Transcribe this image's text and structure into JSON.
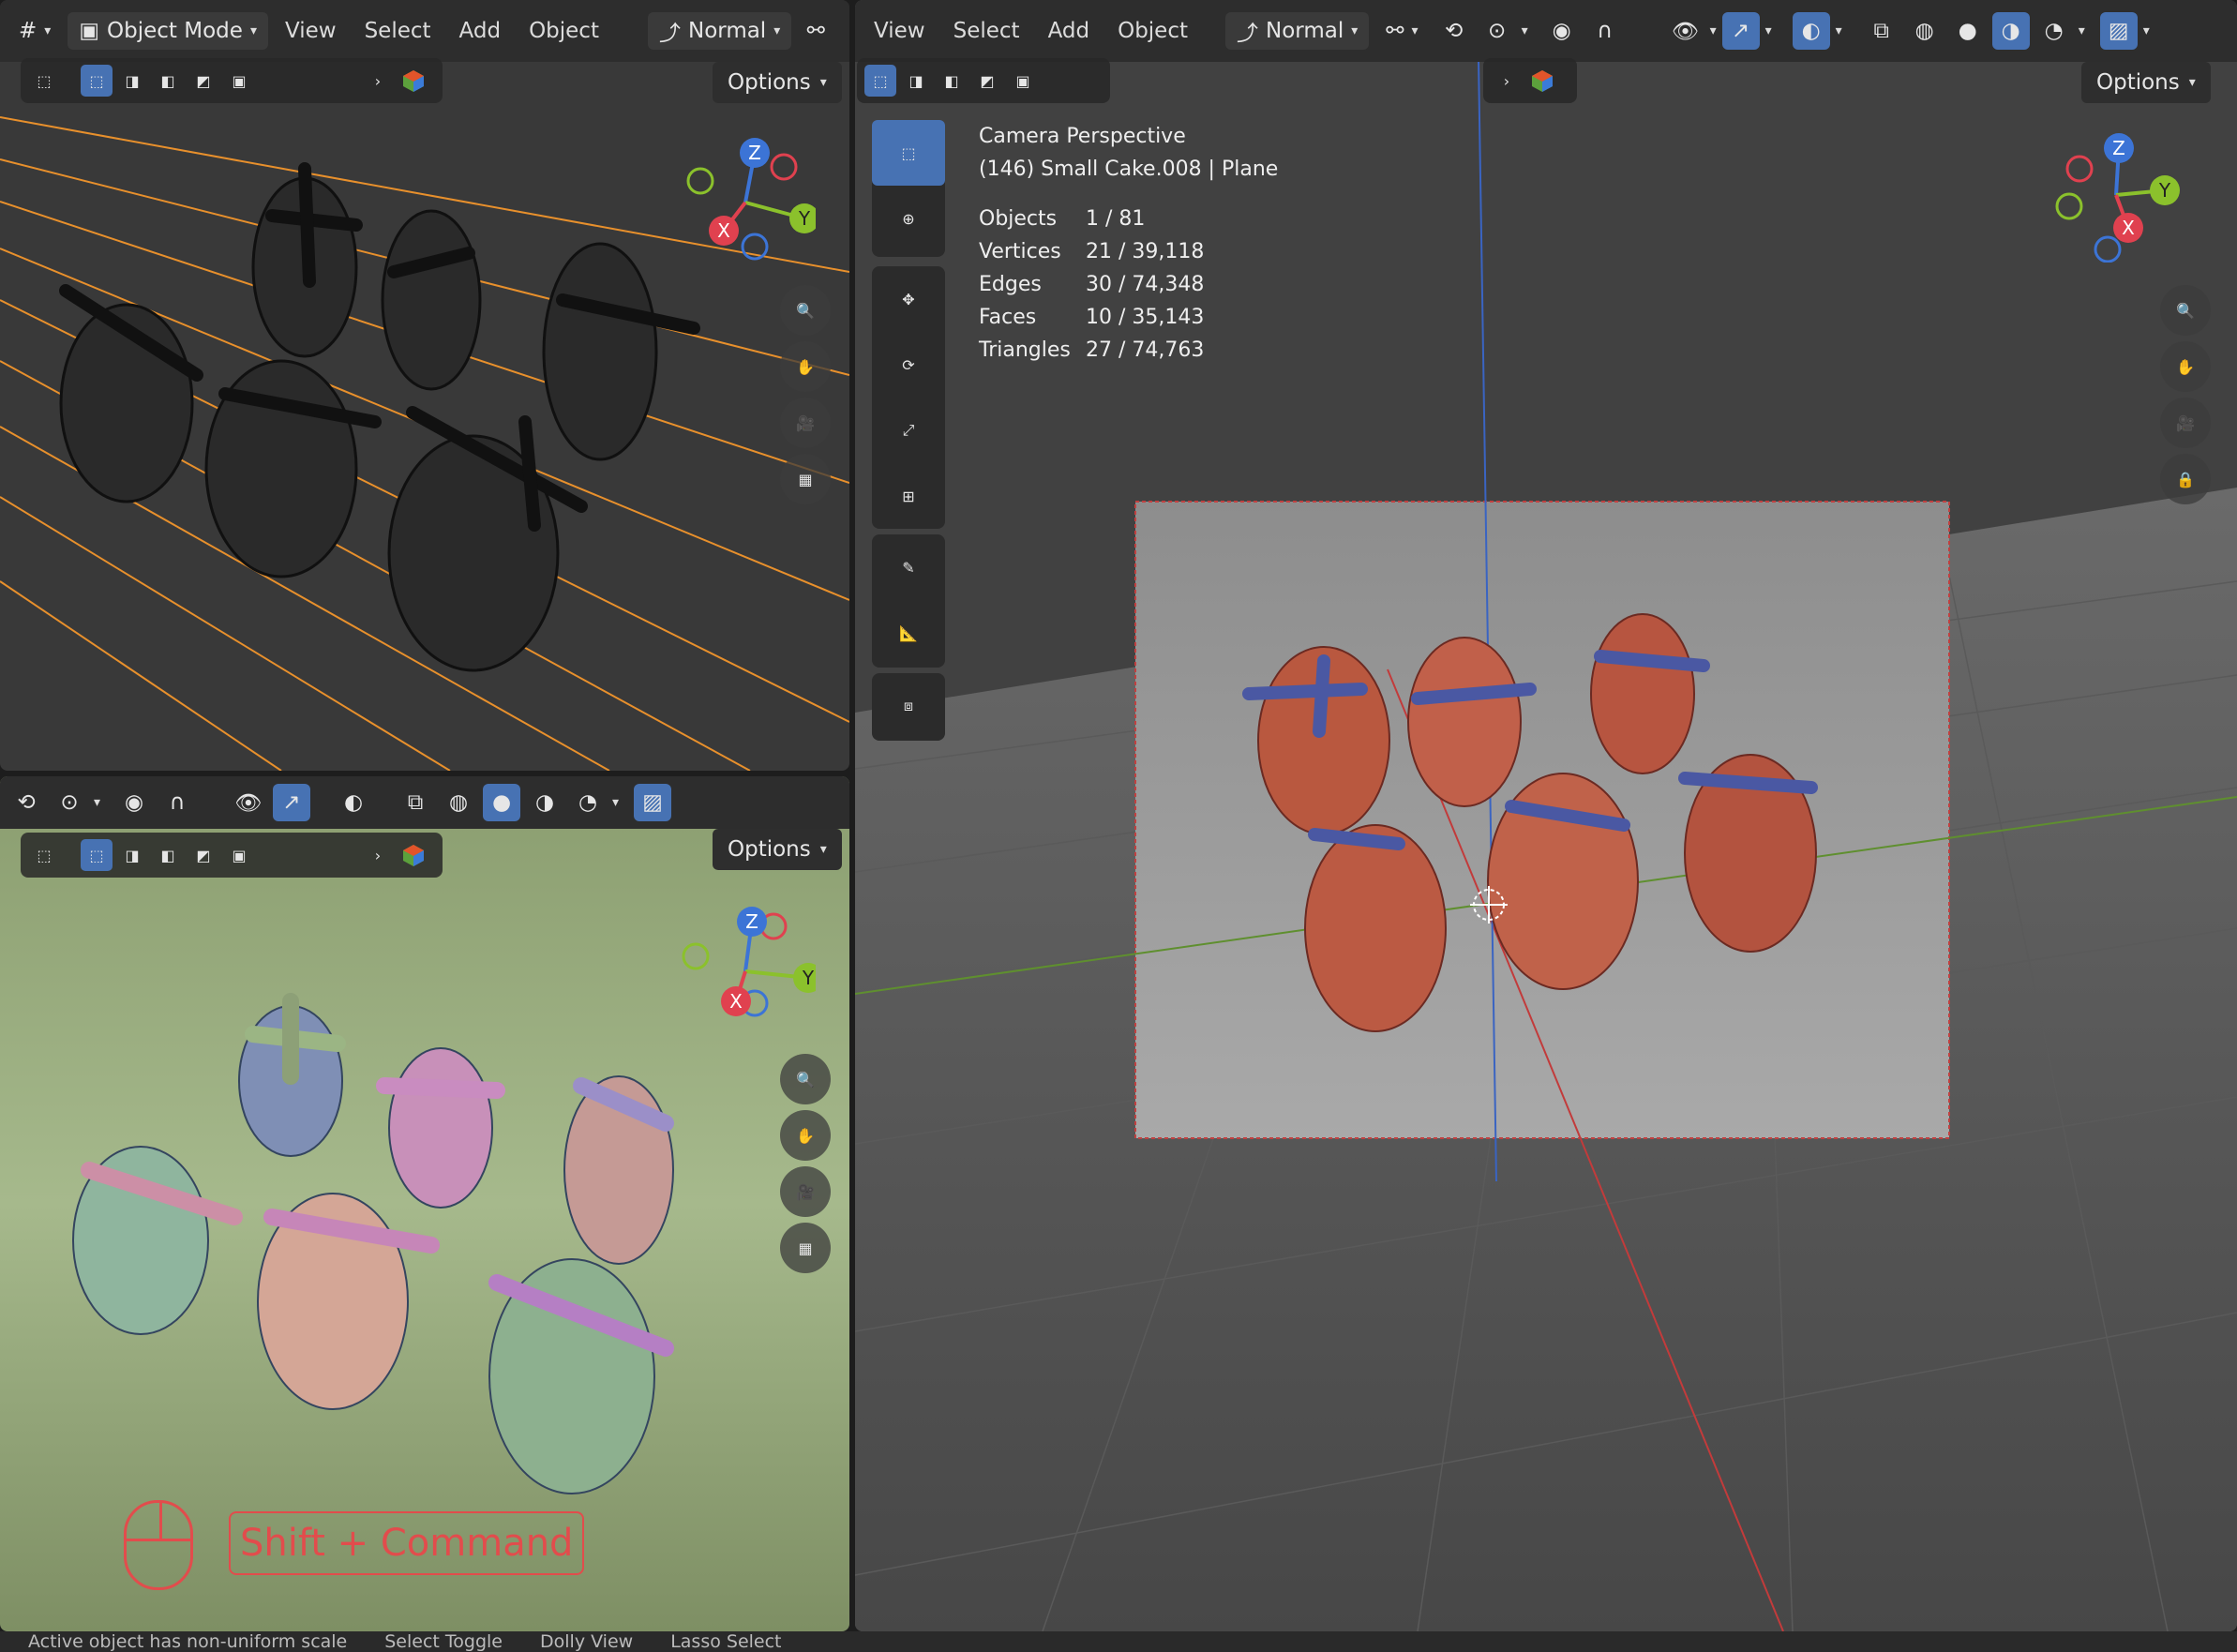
{
  "topleft": {
    "mode_label": "Object Mode",
    "menus": [
      "View",
      "Select",
      "Add",
      "Object"
    ],
    "orientation_label": "Normal",
    "options_label": "Options"
  },
  "bottomleft": {
    "options_label": "Options",
    "shortcut": "Shift + Command"
  },
  "right": {
    "menus": [
      "View",
      "Select",
      "Add",
      "Object"
    ],
    "orientation_label": "Normal",
    "options_label": "Options",
    "overlay": {
      "view_name": "Camera Perspective",
      "object_line": "(146) Small Cake.008 | Plane",
      "stats": [
        {
          "label": "Objects",
          "value": "1 / 81"
        },
        {
          "label": "Vertices",
          "value": "21 / 39,118"
        },
        {
          "label": "Edges",
          "value": "30 / 74,348"
        },
        {
          "label": "Faces",
          "value": "10 / 35,143"
        },
        {
          "label": "Triangles",
          "value": "27 / 74,763"
        }
      ]
    }
  },
  "gizmo_axes": {
    "x": "X",
    "y": "Y",
    "z": "Z"
  },
  "statusbar": {
    "items": [
      "Active object has non-uniform scale",
      "Select Toggle",
      "Dolly View",
      "Lasso Select"
    ]
  },
  "colors": {
    "accent": "#4772b3",
    "x_axis": "#e0414f",
    "y_axis": "#8bc12c",
    "z_axis": "#3c74d6",
    "shortcut": "#e24c4c"
  }
}
